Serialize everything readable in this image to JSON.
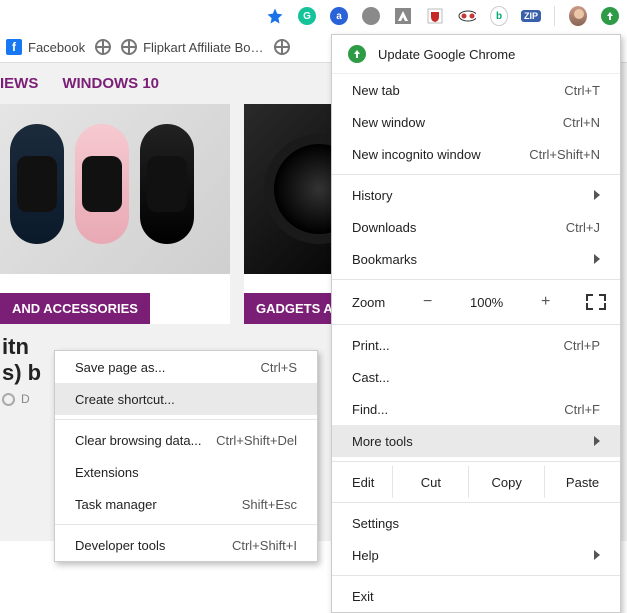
{
  "toolbar_icons": [
    "star",
    "grammarly",
    "amazon",
    "grey-dot",
    "adobe",
    "mcafee",
    "mask",
    "bing",
    "zip"
  ],
  "bookmarks_bar": {
    "fb": "Facebook",
    "flipkart": "Flipkart Affiliate Bo…"
  },
  "nav": {
    "tab1": "IEWS",
    "tab2": "WINDOWS 10"
  },
  "cards": {
    "ribbon1": "AND ACCESSORIES",
    "ribbon2": "GADGETS A"
  },
  "article": {
    "headline_l1": "itn",
    "headline_l2": "s) b",
    "date": "D"
  },
  "main_menu": {
    "update": "Update Google Chrome",
    "new_tab": "New tab",
    "new_tab_sc": "Ctrl+T",
    "new_win": "New window",
    "new_win_sc": "Ctrl+N",
    "incog": "New incognito window",
    "incog_sc": "Ctrl+Shift+N",
    "history": "History",
    "downloads": "Downloads",
    "downloads_sc": "Ctrl+J",
    "bookmarks": "Bookmarks",
    "zoom_lbl": "Zoom",
    "zoom_val": "100%",
    "print": "Print...",
    "print_sc": "Ctrl+P",
    "cast": "Cast...",
    "find": "Find...",
    "find_sc": "Ctrl+F",
    "more_tools": "More tools",
    "edit": "Edit",
    "cut": "Cut",
    "copy": "Copy",
    "paste": "Paste",
    "settings": "Settings",
    "help": "Help",
    "exit": "Exit"
  },
  "sub_menu": {
    "save": "Save page as...",
    "save_sc": "Ctrl+S",
    "shortcut": "Create shortcut...",
    "clear": "Clear browsing data...",
    "clear_sc": "Ctrl+Shift+Del",
    "ext": "Extensions",
    "task": "Task manager",
    "task_sc": "Shift+Esc",
    "dev": "Developer tools",
    "dev_sc": "Ctrl+Shift+I"
  }
}
